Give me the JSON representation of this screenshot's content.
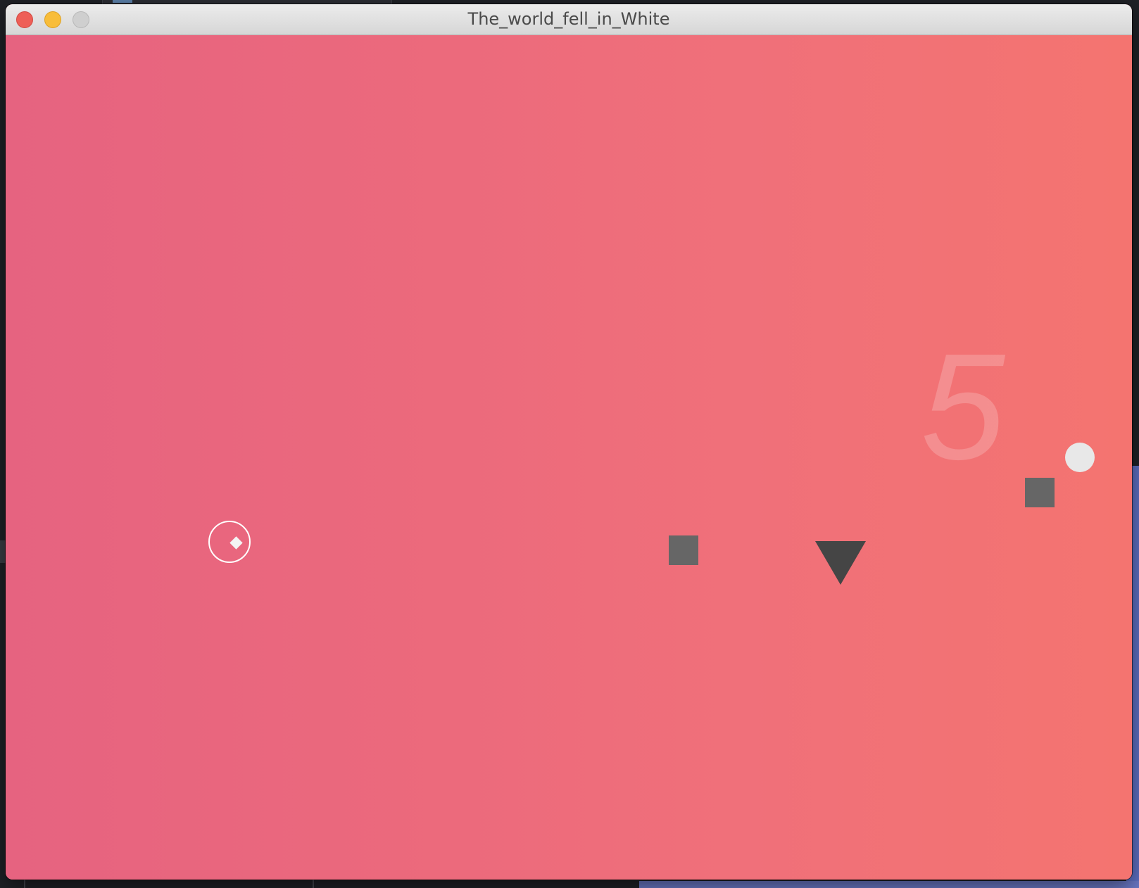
{
  "window": {
    "title": "The_world_fell_in_White"
  },
  "game": {
    "score": "5",
    "colors": {
      "background_left": "#e66380",
      "background_right": "#f47470",
      "block": "#666666",
      "spike": "#454545",
      "orb": "#e8e8e8",
      "player": "#ffffff"
    },
    "icons": {
      "player": "circle-with-diamond",
      "obstacle_block": "square",
      "obstacle_spike": "down-triangle",
      "collectible": "white-circle"
    }
  }
}
